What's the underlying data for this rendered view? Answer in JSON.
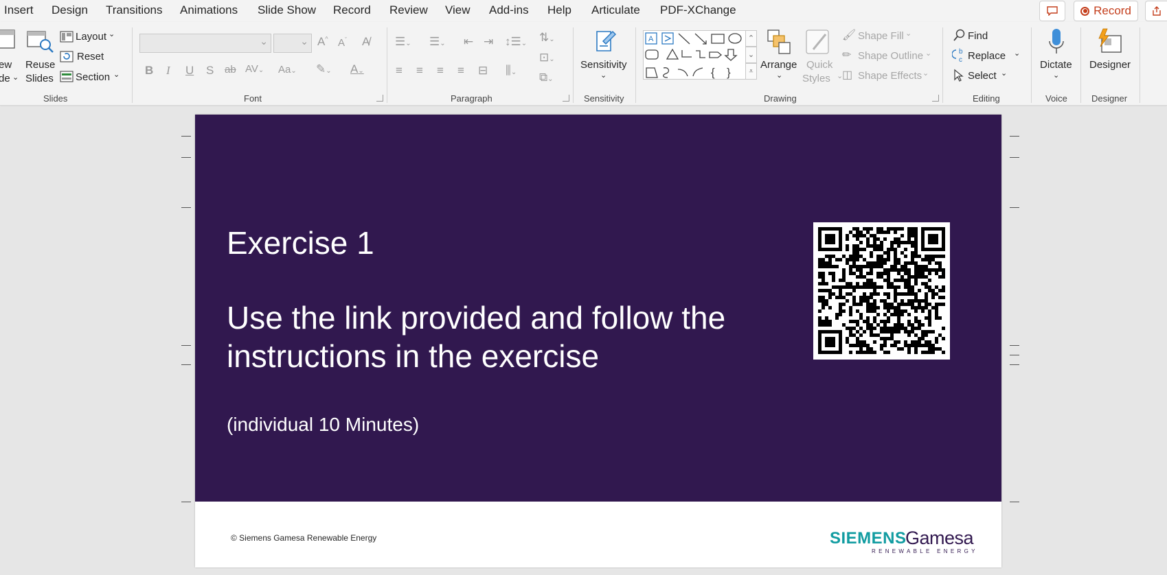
{
  "tabs": [
    "Insert",
    "Design",
    "Transitions",
    "Animations",
    "Slide Show",
    "Record",
    "Review",
    "View",
    "Add-ins",
    "Help",
    "Articulate",
    "PDF-XChange"
  ],
  "record_button": "Record",
  "ribbon": {
    "slides": {
      "new_slide_1": "ew",
      "new_slide_2": "de",
      "reuse_1": "Reuse",
      "reuse_2": "Slides",
      "layout": "Layout",
      "reset": "Reset",
      "section": "Section",
      "group": "Slides"
    },
    "font": {
      "group": "Font",
      "change_case": "Aa"
    },
    "paragraph": {
      "group": "Paragraph"
    },
    "sensitivity": {
      "label": "Sensitivity",
      "group": "Sensitivity"
    },
    "drawing": {
      "arrange": "Arrange",
      "quick_1": "Quick",
      "quick_2": "Styles",
      "shape_fill": "Shape Fill",
      "shape_outline": "Shape Outline",
      "shape_effects": "Shape Effects",
      "group": "Drawing"
    },
    "editing": {
      "find": "Find",
      "replace": "Replace",
      "select": "Select",
      "group": "Editing"
    },
    "voice": {
      "dictate": "Dictate",
      "group": "Voice"
    },
    "designer": {
      "label": "Designer",
      "group": "Designer"
    }
  },
  "slide": {
    "title": "Exercise 1",
    "body": "Use the link provided and follow the instructions in the exercise",
    "note": "(individual 10 Minutes)",
    "copyright": "© Siemens Gamesa Renewable Energy",
    "logo": {
      "siemens": "SIEMENS",
      "gamesa": "Gamesa",
      "tagline": "RENEWABLE ENERGY"
    }
  },
  "colors": {
    "accent": "#c43e1c",
    "slide_band": "#31184f",
    "logo_teal": "#119ca1"
  },
  "icons": [
    "comment-icon",
    "record-icon",
    "share-icon",
    "new-slide-icon",
    "reuse-slides-icon",
    "layout-icon",
    "reset-icon",
    "section-icon",
    "sensitivity-icon",
    "arrange-icon",
    "quick-styles-icon",
    "find-icon",
    "replace-icon",
    "select-icon",
    "microphone-icon",
    "designer-icon",
    "qr-code-icon"
  ]
}
